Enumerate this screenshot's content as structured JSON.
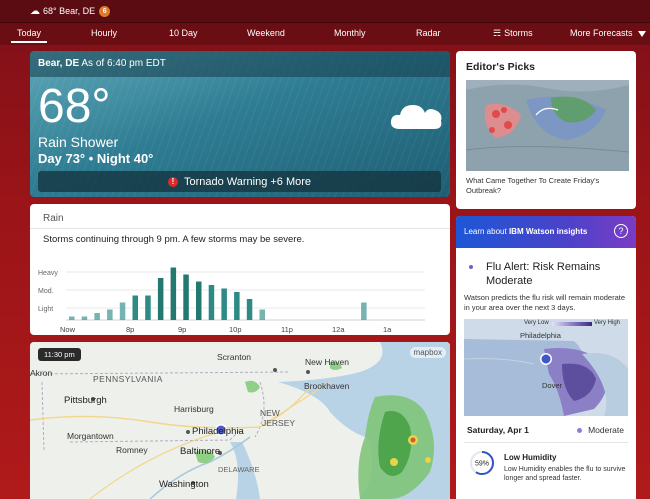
{
  "topbar": {
    "location_temp": "68° Bear, DE",
    "badge_count": "6"
  },
  "nav": {
    "tabs": [
      {
        "label": "Today",
        "active": true
      },
      {
        "label": "Hourly"
      },
      {
        "label": "10 Day"
      },
      {
        "label": "Weekend"
      },
      {
        "label": "Monthly"
      },
      {
        "label": "Radar"
      },
      {
        "label": "Storms"
      },
      {
        "label": "More Forecasts"
      }
    ]
  },
  "current": {
    "location": "Bear, DE",
    "as_of": "As of 6:40 pm EDT",
    "temperature": "68°",
    "condition": "Rain Shower",
    "day_night": "Day 73° • Night 40°",
    "alert": "Tornado Warning +6 More",
    "icon": "cloud-icon"
  },
  "rain": {
    "title": "Rain",
    "summary": "Storms continuing through 9 pm. A few storms may be severe."
  },
  "chart_data": {
    "type": "bar",
    "y_levels": [
      "Heavy",
      "Mod.",
      "Light"
    ],
    "x_tick_labels": [
      "Now",
      "8p",
      "9p",
      "10p",
      "11p",
      "12a",
      "1a"
    ],
    "series": [
      {
        "values": [
          0.1,
          0.1,
          0.2,
          0.3,
          0.5,
          0.7,
          0.7,
          1.2,
          1.5,
          1.3,
          1.1,
          1.0,
          0.9,
          0.8,
          0.6,
          0.3,
          0.0,
          0.0,
          0.0,
          0.0,
          0.0,
          0.0,
          0.0,
          0.5
        ]
      }
    ],
    "ylim": [
      0,
      1.6
    ],
    "color": "#2e8a85"
  },
  "map": {
    "timestamp": "11:30 pm",
    "attribution": "mapbox",
    "labels": [
      {
        "text": "Scranton"
      },
      {
        "text": "New Haven"
      },
      {
        "text": "Akron"
      },
      {
        "text": "PENNSYLVANIA"
      },
      {
        "text": "Brookhaven"
      },
      {
        "text": "Pittsburgh"
      },
      {
        "text": "Harrisburg"
      },
      {
        "text": "NEW"
      },
      {
        "text": "JERSEY"
      },
      {
        "text": "Morgantown"
      },
      {
        "text": "Philadelphia"
      },
      {
        "text": "Romney"
      },
      {
        "text": "Baltimore"
      },
      {
        "text": "DELAWARE"
      },
      {
        "text": "Washington"
      }
    ]
  },
  "picks": {
    "title": "Editor's Picks",
    "caption": "What Came Together To Create Friday's Outbreak?"
  },
  "watson": {
    "header_prefix": "Learn about ",
    "header_bold": "IBM Watson insights",
    "help_label": "?",
    "flu_title": "Flu Alert: Risk Remains Moderate",
    "flu_desc": "Watson predicts the flu risk will remain moderate in your area over the next 3 days.",
    "legend_low": "Very Low",
    "legend_high": "Very High",
    "map_labels": [
      "Philadelphia",
      "Dover"
    ],
    "date": "Saturday, Apr 1",
    "level": "Moderate",
    "humidity_percent": "59%",
    "humidity_fraction": 0.59,
    "humidity_title": "Low Humidity",
    "humidity_desc": "Low Humidity enables the flu to survive longer and spread faster."
  },
  "colors": {
    "background": "#9a1418",
    "rain_bar": "#2e8a85",
    "watson_gradient_start": "#1d57d6",
    "watson_gradient_end": "#7a3cc4",
    "alert_red": "#d92b2b"
  }
}
